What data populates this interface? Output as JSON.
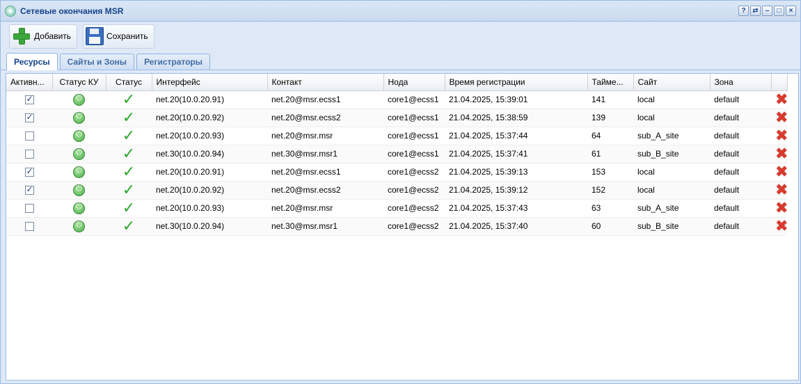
{
  "window": {
    "title": "Сетевые окончания MSR",
    "tools": [
      "?",
      "⇄",
      "–",
      "□",
      "×"
    ]
  },
  "toolbar": {
    "add_label": "Добавить",
    "save_label": "Сохранить"
  },
  "tabs": [
    {
      "label": "Ресурсы",
      "active": true
    },
    {
      "label": "Сайты и Зоны",
      "active": false
    },
    {
      "label": "Регистраторы",
      "active": false
    }
  ],
  "grid": {
    "columns": [
      "Активн...",
      "Статус КУ",
      "Статус",
      "Интерфейс",
      "Контакт",
      "Нода",
      "Время регистрации",
      "Тайме...",
      "Сайт",
      "Зона",
      ""
    ],
    "rows": [
      {
        "active": true,
        "interface": "net.20(10.0.20.91)",
        "contact": "net.20@msr.ecss1",
        "node": "core1@ecss1",
        "time": "21.04.2025, 15:39:01",
        "timer": "141",
        "site": "local",
        "zone": "default"
      },
      {
        "active": true,
        "interface": "net.20(10.0.20.92)",
        "contact": "net.20@msr.ecss2",
        "node": "core1@ecss1",
        "time": "21.04.2025, 15:38:59",
        "timer": "139",
        "site": "local",
        "zone": "default"
      },
      {
        "active": false,
        "interface": "net.20(10.0.20.93)",
        "contact": "net.20@msr.msr",
        "node": "core1@ecss1",
        "time": "21.04.2025, 15:37:44",
        "timer": "64",
        "site": "sub_A_site",
        "zone": "default"
      },
      {
        "active": false,
        "interface": "net.30(10.0.20.94)",
        "contact": "net.30@msr.msr1",
        "node": "core1@ecss1",
        "time": "21.04.2025, 15:37:41",
        "timer": "61",
        "site": "sub_B_site",
        "zone": "default"
      },
      {
        "active": true,
        "interface": "net.20(10.0.20.91)",
        "contact": "net.20@msr.ecss1",
        "node": "core1@ecss2",
        "time": "21.04.2025, 15:39:13",
        "timer": "153",
        "site": "local",
        "zone": "default"
      },
      {
        "active": true,
        "interface": "net.20(10.0.20.92)",
        "contact": "net.20@msr.ecss2",
        "node": "core1@ecss2",
        "time": "21.04.2025, 15:39:12",
        "timer": "152",
        "site": "local",
        "zone": "default"
      },
      {
        "active": false,
        "interface": "net.20(10.0.20.93)",
        "contact": "net.20@msr.msr",
        "node": "core1@ecss2",
        "time": "21.04.2025, 15:37:43",
        "timer": "63",
        "site": "sub_A_site",
        "zone": "default"
      },
      {
        "active": false,
        "interface": "net.30(10.0.20.94)",
        "contact": "net.30@msr.msr1",
        "node": "core1@ecss2",
        "time": "21.04.2025, 15:37:40",
        "timer": "60",
        "site": "sub_B_site",
        "zone": "default"
      }
    ]
  }
}
